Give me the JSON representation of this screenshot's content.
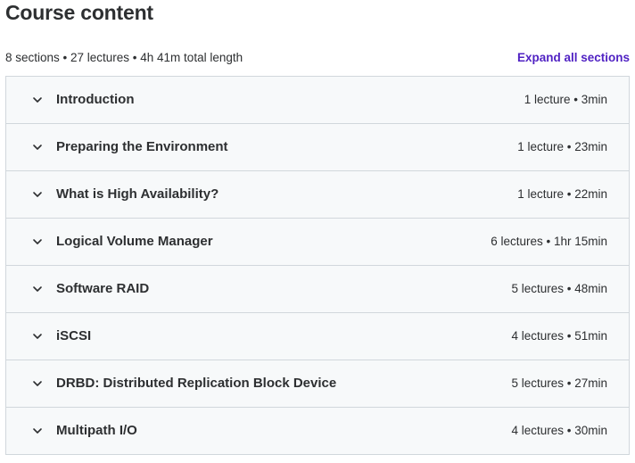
{
  "header": {
    "title": "Course content"
  },
  "summary": {
    "text": "8 sections • 27 lectures • 4h 41m total length",
    "expand_label": "Expand all sections"
  },
  "sections": [
    {
      "title": "Introduction",
      "meta": "1 lecture • 3min"
    },
    {
      "title": "Preparing the Environment",
      "meta": "1 lecture • 23min"
    },
    {
      "title": "What is High Availability?",
      "meta": "1 lecture • 22min"
    },
    {
      "title": "Logical Volume Manager",
      "meta": "6 lectures • 1hr 15min"
    },
    {
      "title": "Software RAID",
      "meta": "5 lectures • 48min"
    },
    {
      "title": "iSCSI",
      "meta": "4 lectures • 51min"
    },
    {
      "title": "DRBD: Distributed Replication Block Device",
      "meta": "5 lectures • 27min"
    },
    {
      "title": "Multipath I/O",
      "meta": "4 lectures • 30min"
    }
  ],
  "colors": {
    "accent": "#5022c3",
    "text": "#2d2f31",
    "section_bg": "#f7f9fa",
    "border": "#d1d7dc"
  },
  "icons": {
    "section_toggle": "chevron-down-icon"
  }
}
